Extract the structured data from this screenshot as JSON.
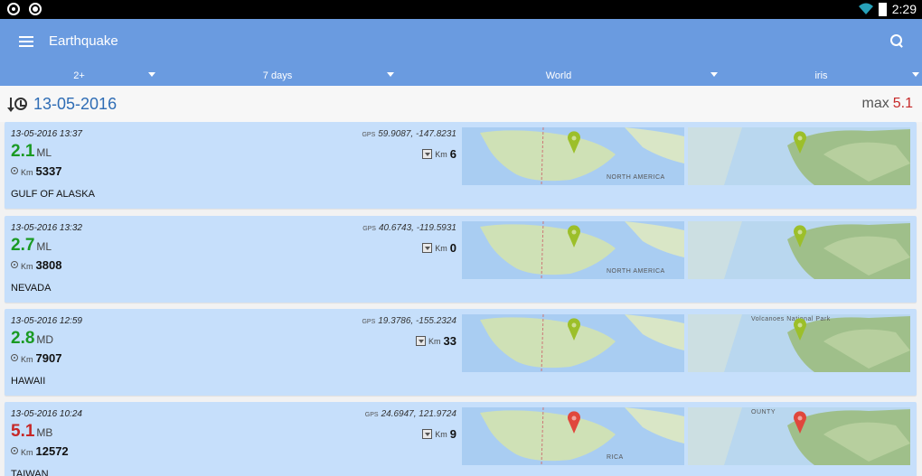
{
  "statusbar": {
    "time": "2:29"
  },
  "appbar": {
    "title": "Earthquake"
  },
  "filters": [
    {
      "label": "2+"
    },
    {
      "label": "7 days"
    },
    {
      "label": "World"
    },
    {
      "label": "iris"
    }
  ],
  "date_header": {
    "date": "13-05-2016",
    "max_label": "max",
    "max_value": "5.1"
  },
  "labels": {
    "gps": "GPS",
    "km": "Km"
  },
  "quakes": [
    {
      "datetime": "13-05-2016 13:37",
      "gps": "59.9087, -147.8231",
      "magnitude": "2.1",
      "mag_type": "ML",
      "distance": "5337",
      "depth": "6",
      "region": "GULF OF ALASKA",
      "level": "green",
      "map_label_world": "NORTH AMERICA",
      "map_label_zoom": ""
    },
    {
      "datetime": "13-05-2016 13:32",
      "gps": "40.6743, -119.5931",
      "magnitude": "2.7",
      "mag_type": "ML",
      "distance": "3808",
      "depth": "0",
      "region": "NEVADA",
      "level": "green",
      "map_label_world": "NORTH AMERICA",
      "map_label_zoom": ""
    },
    {
      "datetime": "13-05-2016 12:59",
      "gps": "19.3786, -155.2324",
      "magnitude": "2.8",
      "mag_type": "MD",
      "distance": "7907",
      "depth": "33",
      "region": "HAWAII",
      "level": "green",
      "map_label_world": "",
      "map_label_zoom": "Volcanoes National Park"
    },
    {
      "datetime": "13-05-2016 10:24",
      "gps": "24.6947, 121.9724",
      "magnitude": "5.1",
      "mag_type": "MB",
      "distance": "12572",
      "depth": "9",
      "region": "TAIWAN",
      "level": "red",
      "map_label_world": "RICA",
      "map_label_zoom": "OUNTY"
    }
  ],
  "colors": {
    "green": "#1a9a23",
    "red": "#c62828",
    "accent": "#6a9be0",
    "card": "#c6dffb"
  }
}
